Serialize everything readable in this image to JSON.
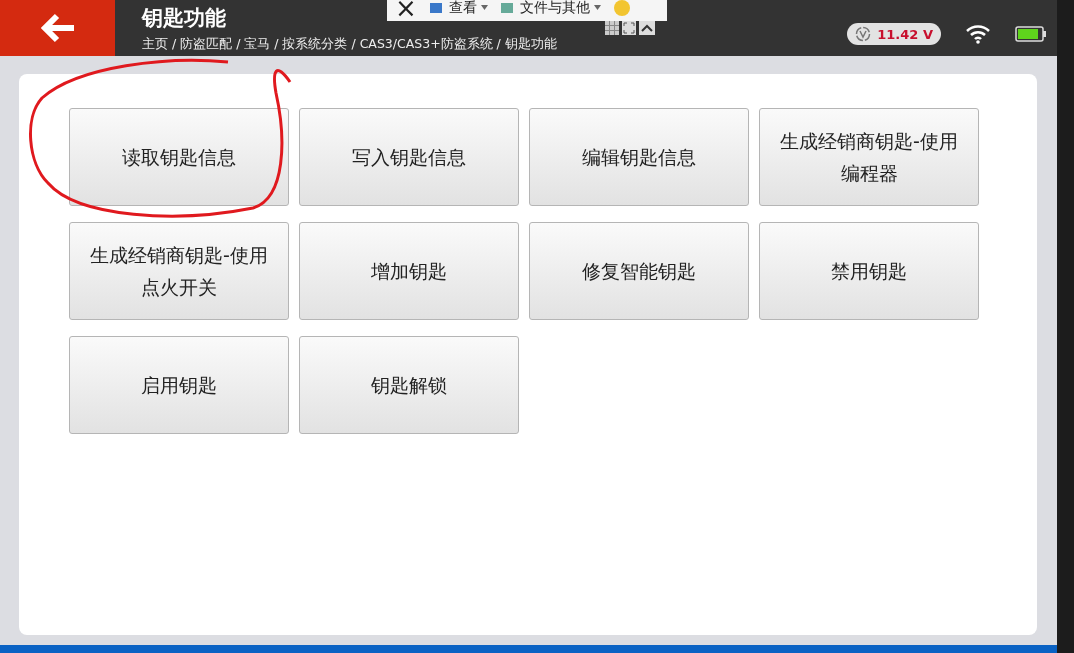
{
  "header": {
    "title": "钥匙功能",
    "breadcrumb": "主页 / 防盗匹配 / 宝马 / 按系统分类 / CAS3/CAS3+防盗系统 / 钥匙功能",
    "voltage": "11.42 V"
  },
  "overlay_toolbar": {
    "items": [
      {
        "kind": "close",
        "label": "×"
      },
      {
        "kind": "menu",
        "label": "查看"
      },
      {
        "kind": "menu",
        "label": "文件与其他"
      }
    ]
  },
  "functions": [
    {
      "label": "读取钥匙信息"
    },
    {
      "label": "写入钥匙信息"
    },
    {
      "label": "编辑钥匙信息"
    },
    {
      "label": "生成经销商钥匙-使用编程器"
    },
    {
      "label": "生成经销商钥匙-使用点火开关"
    },
    {
      "label": "增加钥匙"
    },
    {
      "label": "修复智能钥匙"
    },
    {
      "label": "禁用钥匙"
    },
    {
      "label": "启用钥匙"
    },
    {
      "label": "钥匙解锁"
    }
  ]
}
